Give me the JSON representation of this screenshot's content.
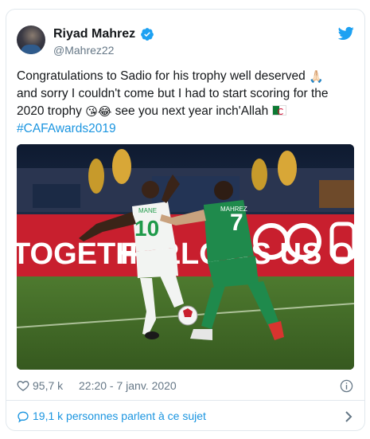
{
  "author": {
    "name": "Riyad Mahrez",
    "handle": "@Mahrez22"
  },
  "tweet": {
    "line1": "Congratulations to Sadio for his trophy well deserved",
    "line2": "and sorry I couldn't come but I had to start scoring for the",
    "line3a": "2020 trophy",
    "line3b": "see you next year inch'Allah",
    "hashtag": "#CAFAwards2019",
    "emoji_praying": "🙏🏻",
    "emoji_kiss": "😘",
    "emoji_joy": "😂"
  },
  "photo": {
    "banner_left": "TOGETHER",
    "banner_mid": "FOLLOWS US ON",
    "jersey_white_name": "MANE",
    "jersey_white_number": "10",
    "jersey_green_name": "MAHREZ",
    "jersey_green_number": "7"
  },
  "meta": {
    "likes": "95,7 k",
    "timestamp": "22:20 - 7 janv. 2020"
  },
  "conversation": {
    "label": "19,1 k personnes parlent à ce sujet"
  },
  "colors": {
    "twitter_blue": "#1da1f2",
    "link_blue": "#1b95e0",
    "muted": "#657786",
    "border": "#e1e8ed"
  },
  "icons": {
    "verified": "verified-badge-icon",
    "brand": "twitter-bird-icon",
    "like": "heart-icon",
    "info": "info-icon",
    "reply": "speech-bubble-icon",
    "chevron": "chevron-right-icon"
  }
}
